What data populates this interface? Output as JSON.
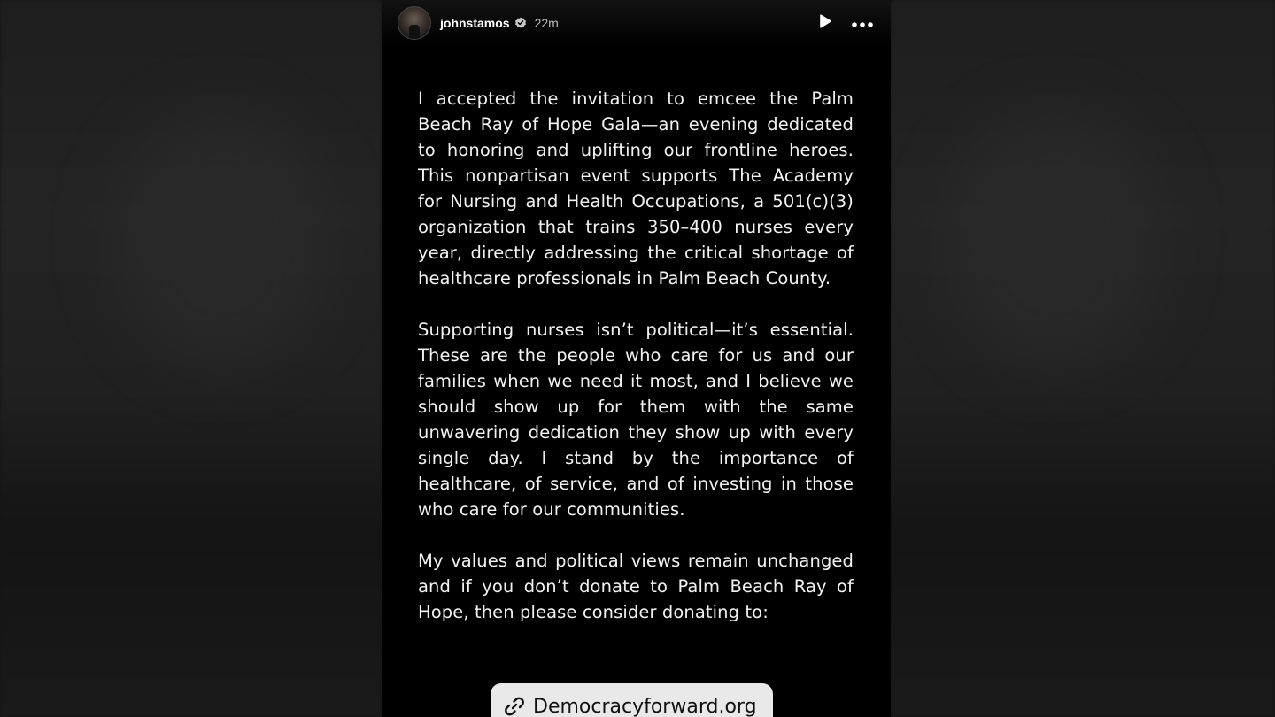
{
  "header": {
    "username": "johnstamos",
    "timestamp": "22m",
    "verified": true
  },
  "body": {
    "paragraphs": [
      "I accepted the invitation to emcee the Palm Beach Ray of Hope Gala—an evening dedicated to honoring and uplifting our frontline heroes. This nonpartisan event supports The Academy for Nursing and Health Occupations, a 501(c)(3) organization that trains 350–400 nurses every year, directly addressing the critical shortage of healthcare professionals in Palm Beach County.",
      "Supporting nurses isn’t political—it’s essential. These are the people who care for us and our families when we need it most, and I believe we should show up for them with the same unwavering dedication they show up with every single day.  I stand by the importance of healthcare, of service, and of investing in those who care for our communities.",
      "My values and political views remain unchanged and if you don’t donate to Palm Beach Ray of Hope, then please consider donating to:"
    ]
  },
  "link_sticker": {
    "label": "Democracyforward.org"
  },
  "icons": {
    "verified": "verified-badge-icon",
    "play": "play-icon",
    "more": "more-options-icon",
    "link": "link-icon"
  },
  "colors": {
    "story_background": "#000000",
    "text": "#f2f2f2",
    "sticker_background": "#e9e9e9"
  }
}
